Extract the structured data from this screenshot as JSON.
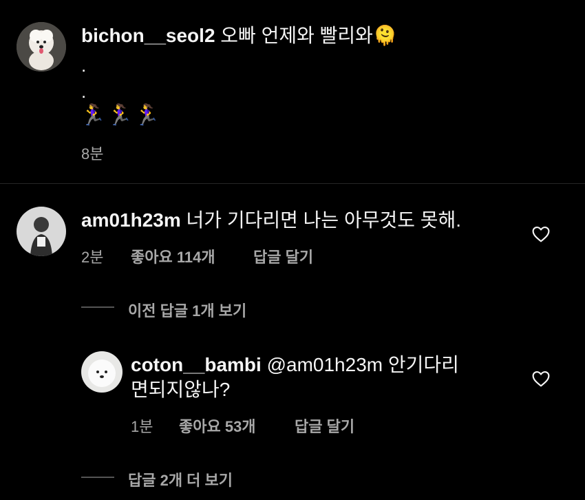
{
  "comment1": {
    "username": "bichon__seol2",
    "text": "오빠 언제와 빨리와",
    "emoji": "🫠",
    "dot1": ".",
    "dot2": ".",
    "runners": "🏃‍♀️🏃‍♀️🏃‍♀️",
    "time": "8분"
  },
  "comment2": {
    "username": "am01h23m",
    "text": "너가 기다리면 나는 아무것도 못해.",
    "time": "2분",
    "likes": "좋아요 114개",
    "reply": "답글 달기",
    "view_previous": "이전 답글 1개 보기"
  },
  "reply1": {
    "username": "coton__bambi",
    "mention": "@am01h23m",
    "text_line1": "안기다리",
    "text_line2": "면되지않나?",
    "time": "1분",
    "likes": "좋아요 53개",
    "reply": "답글 달기",
    "view_more": "답글 2개 더 보기"
  },
  "icons": {
    "heart": "heart-outline-icon"
  }
}
